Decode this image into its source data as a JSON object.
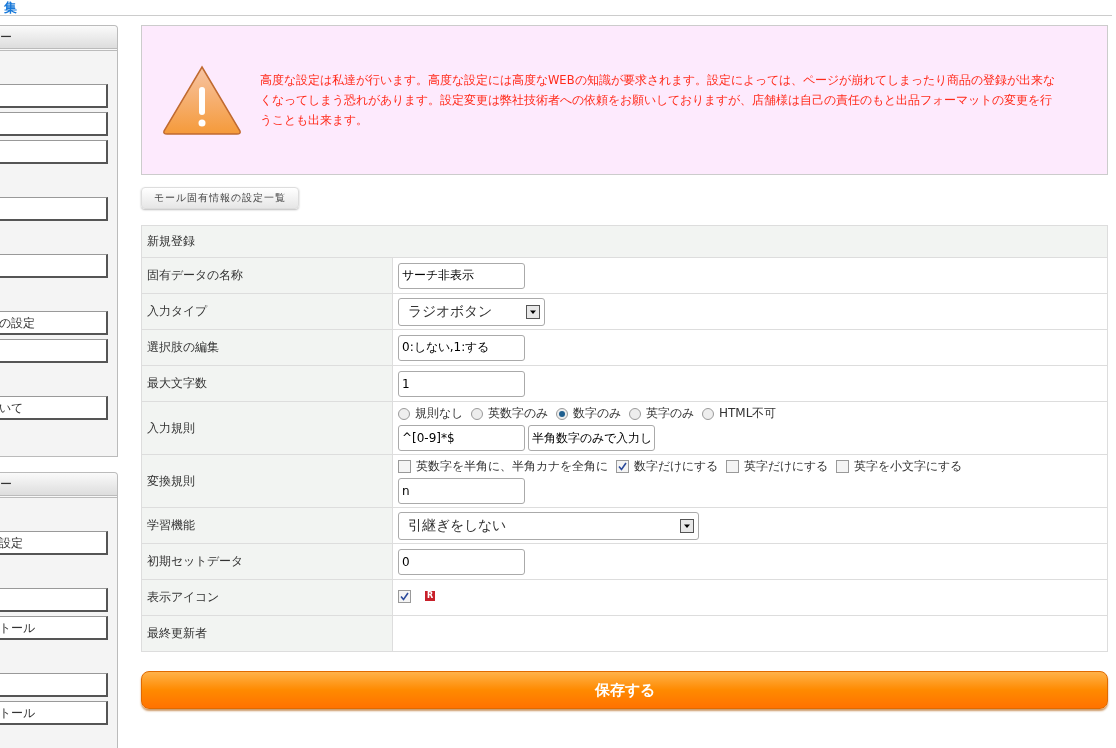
{
  "top_bar": {
    "title": "集"
  },
  "sidebar": {
    "panels": [
      {
        "title": "ー",
        "groups": [
          [
            {
              "kind": "blank"
            },
            {
              "kind": "blank"
            },
            {
              "kind": "blank"
            }
          ],
          [
            {
              "kind": "blank"
            }
          ],
          [
            {
              "kind": "blank"
            }
          ],
          [
            {
              "kind": "labeled",
              "label": "の設定"
            },
            {
              "kind": "blank"
            }
          ],
          [
            {
              "kind": "labeled",
              "label": "いて"
            }
          ]
        ]
      },
      {
        "title": "ー",
        "groups": [
          [
            {
              "kind": "labeled",
              "label": "設定"
            }
          ],
          [
            {
              "kind": "blank"
            },
            {
              "kind": "labeled",
              "label": "トール"
            }
          ],
          [
            {
              "kind": "blank"
            },
            {
              "kind": "labeled",
              "label": "トール"
            }
          ]
        ]
      }
    ]
  },
  "warning": {
    "text": "高度な設定は私達が行います。高度な設定には高度なWEBの知識が要求されます。設定によっては、ページが崩れてしまったり商品の登録が出来なくなってしまう恐れがあります。設定変更は弊社技術者への依頼をお願いしておりますが、店舗様は自己の責任のもと出品フォーマットの変更を行うことも出来ます。"
  },
  "list_button": "モール固有情報の設定一覧",
  "form": {
    "title": "新規登録",
    "rows": [
      {
        "label": "固有データの名称",
        "kind": "text",
        "value": "サーチ非表示"
      },
      {
        "label": "入力タイプ",
        "kind": "select",
        "value": "ラジオボタン",
        "wide": false
      },
      {
        "label": "選択肢の編集",
        "kind": "text",
        "value": "0:しない,1:する"
      },
      {
        "label": "最大文字数",
        "kind": "text",
        "value": "1"
      },
      {
        "label": "入力規則",
        "kind": "radio",
        "options": [
          {
            "label": "規則なし",
            "selected": false
          },
          {
            "label": "英数字のみ",
            "selected": false
          },
          {
            "label": "数字のみ",
            "selected": true
          },
          {
            "label": "英字のみ",
            "selected": false
          },
          {
            "label": "HTML不可",
            "selected": false
          }
        ],
        "fields": [
          "^[0-9]*$",
          "半角数字のみで入力し"
        ]
      },
      {
        "label": "変換規則",
        "kind": "checkbox",
        "options": [
          {
            "label": "英数字を半角に、半角カナを全角に",
            "checked": false
          },
          {
            "label": "数字だけにする",
            "checked": true
          },
          {
            "label": "英字だけにする",
            "checked": false
          },
          {
            "label": "英字を小文字にする",
            "checked": false
          }
        ],
        "fields": [
          "n"
        ]
      },
      {
        "label": "学習機能",
        "kind": "select",
        "value": "引継ぎをしない",
        "wide": true
      },
      {
        "label": "初期セットデータ",
        "kind": "text",
        "value": "0"
      },
      {
        "label": "表示アイコン",
        "kind": "icon",
        "checked": true,
        "badge": "R"
      },
      {
        "label": "最終更新者",
        "kind": "empty"
      }
    ]
  },
  "save_button": "保存する"
}
